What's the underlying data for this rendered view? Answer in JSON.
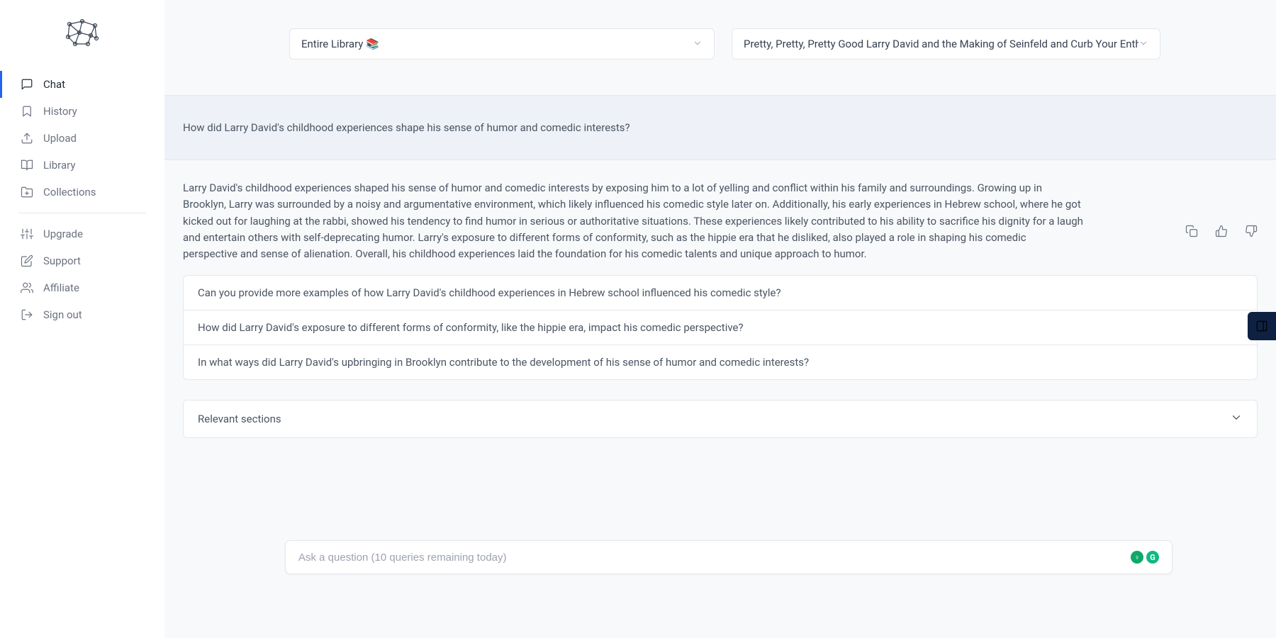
{
  "sidebar": {
    "items": [
      {
        "label": "Chat"
      },
      {
        "label": "History"
      },
      {
        "label": "Upload"
      },
      {
        "label": "Library"
      },
      {
        "label": "Collections"
      }
    ],
    "items2": [
      {
        "label": "Upgrade"
      },
      {
        "label": "Support"
      },
      {
        "label": "Affiliate"
      },
      {
        "label": "Sign out"
      }
    ]
  },
  "topbar": {
    "scope": "Entire Library 📚",
    "document": "Pretty, Pretty, Pretty Good Larry David and the Making of Seinfeld and Curb Your Enthusia"
  },
  "conversation": {
    "question": "How did Larry David's childhood experiences shape his sense of humor and comedic interests?",
    "answer": "Larry David's childhood experiences shaped his sense of humor and comedic interests by exposing him to a lot of yelling and conflict within his family and surroundings. Growing up in Brooklyn, Larry was surrounded by a noisy and argumentative environment, which likely influenced his comedic style later on. Additionally, his early experiences in Hebrew school, where he got kicked out for laughing at the rabbi, showed his tendency to find humor in serious or authoritative situations. These experiences likely contributed to his ability to sacrifice his dignity for a laugh and entertain others with self-deprecating humor. Larry's exposure to different forms of conformity, such as the hippie era that he disliked, also played a role in shaping his comedic perspective and sense of alienation. Overall, his childhood experiences laid the foundation for his comedic talents and unique approach to humor."
  },
  "suggestions": [
    "Can you provide more examples of how Larry David's childhood experiences in Hebrew school influenced his comedic style?",
    "How did Larry David's exposure to different forms of conformity, like the hippie era, impact his comedic perspective?",
    "In what ways did Larry David's upbringing in Brooklyn contribute to the development of his sense of humor and comedic interests?"
  ],
  "relevant": {
    "label": "Relevant sections"
  },
  "input": {
    "placeholder": "Ask a question (10 queries remaining today)"
  }
}
